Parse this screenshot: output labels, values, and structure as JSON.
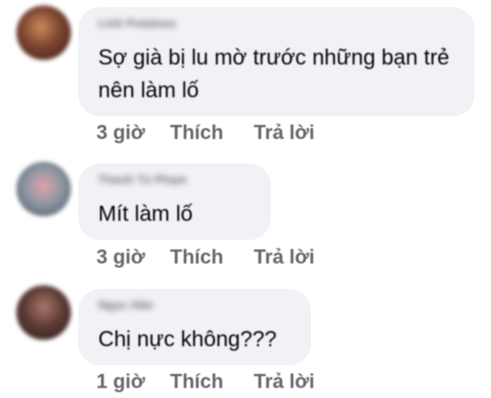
{
  "comments": [
    {
      "author": "Linh Potatoes",
      "text": "Sợ già bị lu mờ trước những bạn trẻ nên làm lố",
      "time": "3 giờ",
      "like": "Thích",
      "reply": "Trả lời",
      "avatar_color": "#6b3a2a"
    },
    {
      "author": "Thanh Tú Phạm",
      "text": "Mít làm lố",
      "time": "3 giờ",
      "like": "Thích",
      "reply": "Trả lời",
      "avatar_color": "#7b8694"
    },
    {
      "author": "Ngọc Hân",
      "text": "Chị nực không???",
      "time": "1 giờ",
      "like": "Thích",
      "reply": "Trả lời",
      "avatar_color": "#5a3a36"
    }
  ]
}
